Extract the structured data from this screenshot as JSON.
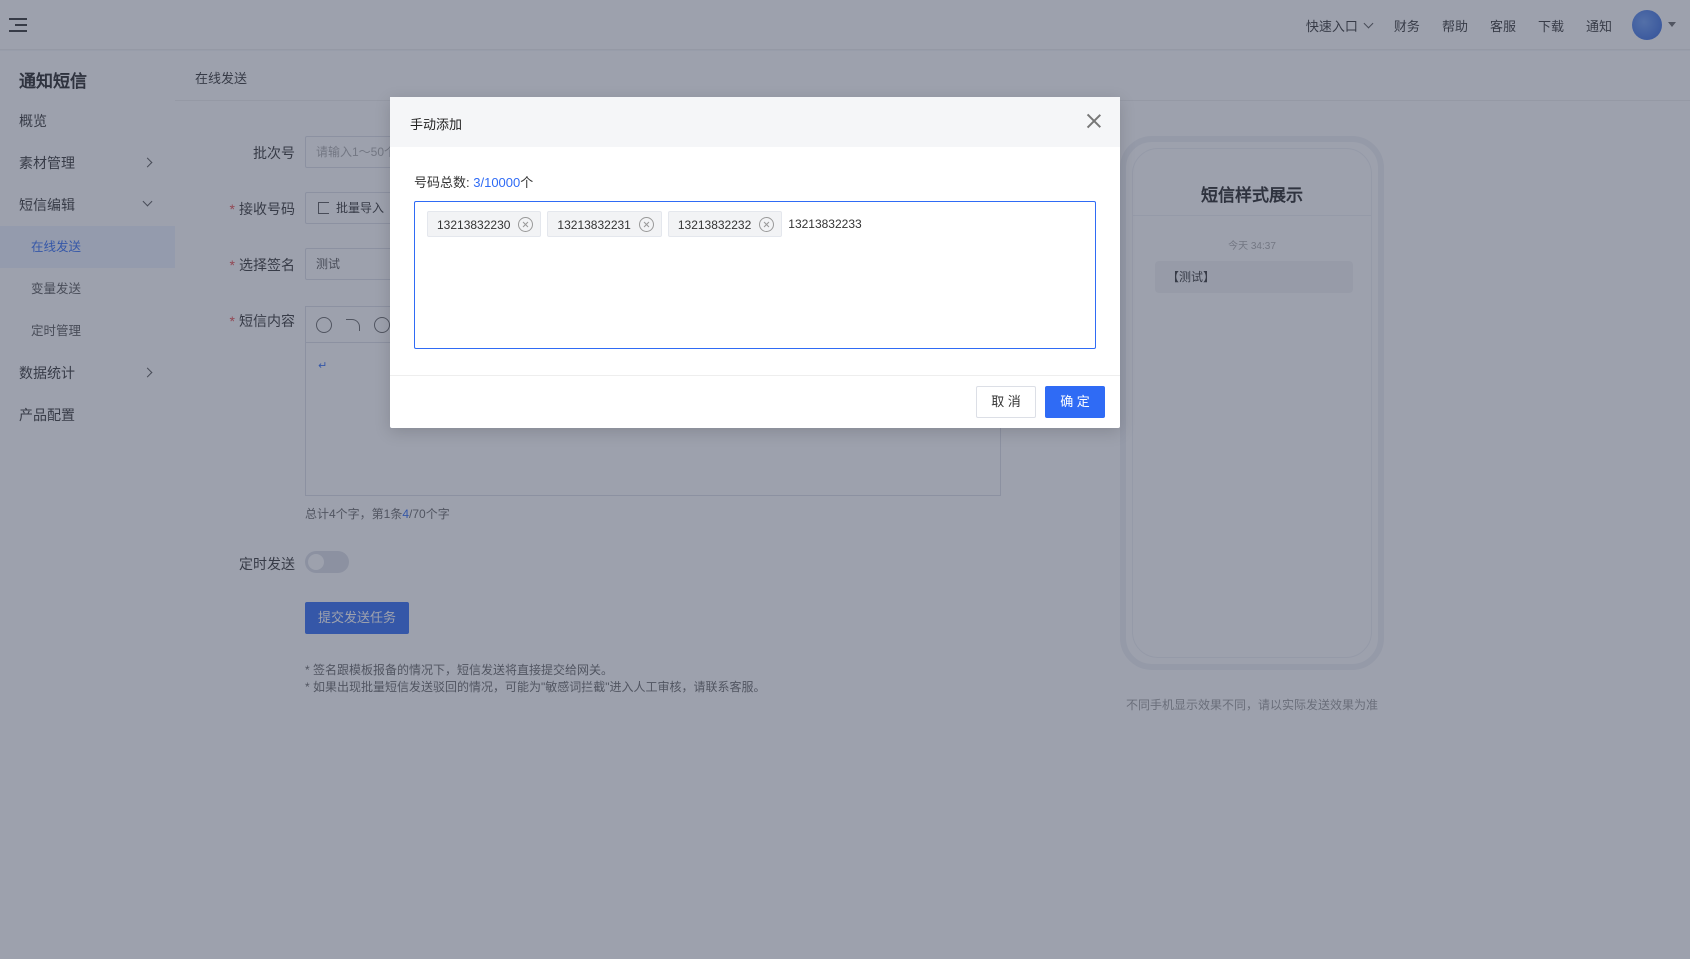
{
  "header": {
    "links": [
      "快速入口",
      "财务",
      "帮助",
      "客服",
      "下载",
      "通知"
    ]
  },
  "sidebar": {
    "title": "通知短信",
    "items": [
      {
        "label": "概览"
      },
      {
        "label": "素材管理"
      },
      {
        "label": "短信编辑"
      },
      {
        "label": "在线发送"
      },
      {
        "label": "变量发送"
      },
      {
        "label": "定时管理"
      },
      {
        "label": "数据统计"
      },
      {
        "label": "产品配置"
      }
    ]
  },
  "breadcrumb": "在线发送",
  "form": {
    "batch_label": "批次号",
    "batch_placeholder": "请输入1～50个",
    "receiver_label": "接收号码",
    "import_button": "批量导入",
    "signature_label": "选择签名",
    "signature_value": "测试",
    "content_label": "短信内容",
    "count_prefix": "总计4个字，第1条",
    "count_current": "4",
    "count_suffix": "/70个字",
    "schedule_label": "定时发送",
    "submit_button": "提交发送任务",
    "note1": "* 签名跟模板报备的情况下，短信发送将直接提交给网关。",
    "note2": "* 如果出现批量短信发送驳回的情况，可能为\"敏感词拦截\"进入人工审核，请联系客服。"
  },
  "preview": {
    "title": "短信样式展示",
    "time": "今天 34:37",
    "message": "【测试】",
    "note": "不同手机显示效果不同，请以实际发送效果为准"
  },
  "modal": {
    "title": "手动添加",
    "total_label": "号码总数:",
    "total_current": "3",
    "total_max": "/10000",
    "total_unit": "个",
    "tags": [
      "13213832230",
      "13213832231",
      "13213832232"
    ],
    "input_value": "13213832233",
    "cancel_button": "取 消",
    "ok_button": "确 定"
  }
}
